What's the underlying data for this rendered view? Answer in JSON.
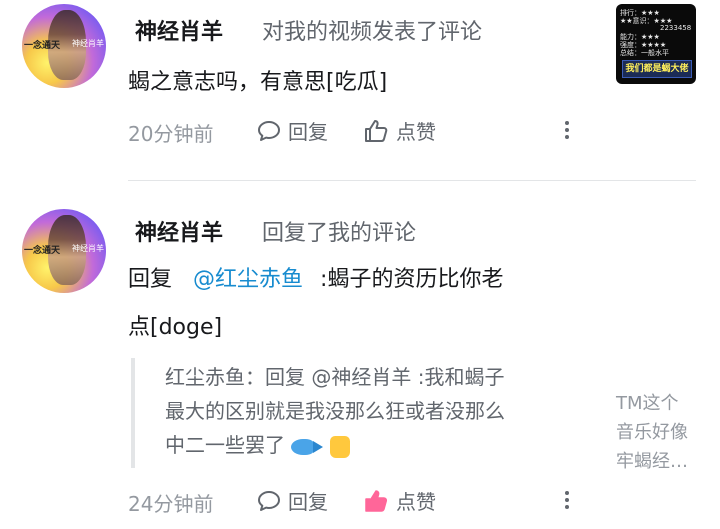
{
  "comment1": {
    "username": "神经肖羊",
    "action": "对我的视频发表了评论",
    "text": "蝎之意志吗，有意思[吃瓜]",
    "time": "20分钟前",
    "reply_label": "回复",
    "like_label": "点赞",
    "avatar_tags": [
      "一念通天",
      "神经肖羊"
    ],
    "thumb_lines": [
      "排行：★★★",
      "★★意识：★★★",
      "2233458",
      "能力：★★★",
      "强度：★★★★",
      "总结：一般水平"
    ],
    "thumb_banner": "我们都是蝎大佬"
  },
  "comment2": {
    "username": "神经肖羊",
    "action": "回复了我的评论",
    "reply_prefix": "回复",
    "mention": "@红尘赤鱼",
    "text_rest": ":蝎子的资历比你老",
    "text_line2": "点[doge]",
    "quote_line1": "红尘赤鱼：回复 @神经肖羊 :我和蝎子",
    "quote_line2": "最大的区别就是我没那么狂或者没那么",
    "quote_line3": "中二一些罢了",
    "time": "24分钟前",
    "reply_label": "回复",
    "like_label": "点赞",
    "preview_lines": [
      "TM这个",
      "音乐好像",
      "牢蝎经…"
    ]
  },
  "colors": {
    "mention": "#178bcf",
    "like_active": "#ff6699",
    "meta": "#9499a0"
  }
}
